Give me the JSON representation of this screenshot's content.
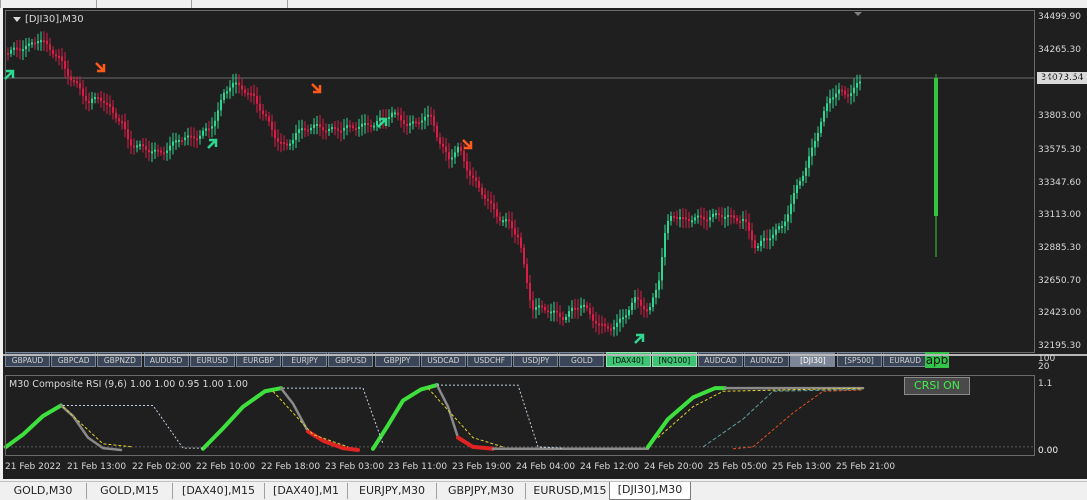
{
  "window": {
    "title": "[DJI30],M30",
    "current_price": "34073.54"
  },
  "y_axis_main": [
    "34499.90",
    "34265.30",
    "34037.75",
    "33803.00",
    "33575.30",
    "33347.60",
    "33113.00",
    "32885.30",
    "32650.70",
    "32423.00",
    "32195.30"
  ],
  "y_axis_sub": [
    "100",
    "20",
    "1.1",
    "0.00",
    "0.00"
  ],
  "ticker_buttons": [
    "GBPAUD",
    "GBPCAD",
    "GBPNZD",
    "AUDUSD",
    "EURUSD",
    "EURGBP",
    "EURJPY",
    "GBPUSD",
    "GBPJPY",
    "USDCAD",
    "USDCHF",
    "USDJPY",
    "GOLD",
    "[DAX40]",
    "[NQ100]",
    "AUDCAD",
    "AUDNZD",
    "[DJI30]",
    "[SP500]",
    "EURAUD"
  ],
  "apb_label": "apb",
  "indicator": {
    "title": "M30 Composite RSI (9,6) 1.00 1.00 0.95 1.00 1.00",
    "button": "CRSI ON"
  },
  "x_axis": [
    "21 Feb 2022",
    "21 Feb 13:00",
    "22 Feb 02:00",
    "22 Feb 10:00",
    "22 Feb 18:00",
    "23 Feb 03:00",
    "23 Feb 11:00",
    "23 Feb 19:00",
    "24 Feb 04:00",
    "24 Feb 12:00",
    "24 Feb 20:00",
    "25 Feb 05:00",
    "25 Feb 13:00",
    "25 Feb 21:00"
  ],
  "tabs": [
    "GOLD,M30",
    "GOLD,M15",
    "[DAX40],M15",
    "[DAX40],M1",
    "EURJPY,M30",
    "GBPJPY,M30",
    "EURUSD,M15",
    "[DJI30],M30"
  ],
  "active_tab": "[DJI30],M30",
  "colors": {
    "bull": "#2fd68f",
    "bear": "#d81e47",
    "crsi_up": "#3ee03e",
    "crsi_down": "#e02424",
    "crsi_mid": "#8a8a8a",
    "arrow_up": "#2fd68f",
    "arrow_down": "#ff5a1a"
  }
}
